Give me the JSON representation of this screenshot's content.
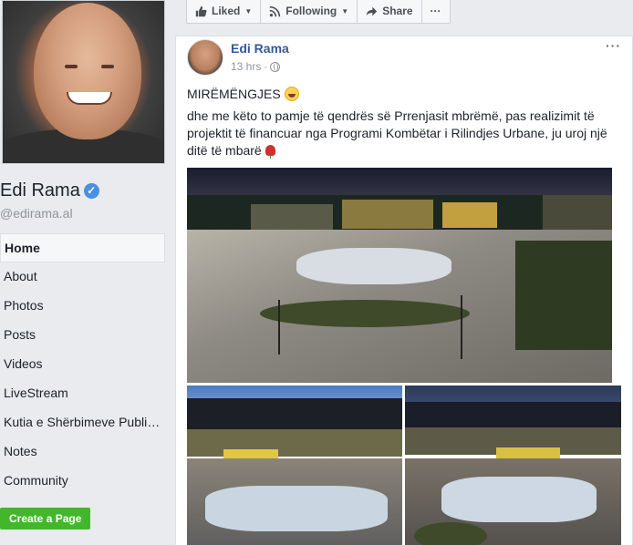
{
  "sidebar": {
    "page_name": "Edi Rama",
    "handle": "@edirama.al",
    "nav": [
      {
        "label": "Home",
        "active": true
      },
      {
        "label": "About"
      },
      {
        "label": "Photos"
      },
      {
        "label": "Posts"
      },
      {
        "label": "Videos"
      },
      {
        "label": "LiveStream"
      },
      {
        "label": "Kutia e Shërbimeve Publi…"
      },
      {
        "label": "Notes"
      },
      {
        "label": "Community"
      }
    ],
    "create_page": "Create a Page"
  },
  "actionbar": {
    "liked": "Liked",
    "following": "Following",
    "share": "Share",
    "more": "···"
  },
  "post": {
    "author": "Edi Rama",
    "time": "13 hrs",
    "more": "···",
    "greeting": "MIRËMËNGJES",
    "body": "dhe me këto to pamje të qendrës së Prrenjasit mbrëmë, pas realizimit të projektit të financuar nga Programi Kombëtar i Rilindjes Urbane, ju uroj një ditë të mbarë"
  },
  "colors": {
    "link": "#365899",
    "create_button": "#42b72a",
    "background": "#e9ebee"
  }
}
